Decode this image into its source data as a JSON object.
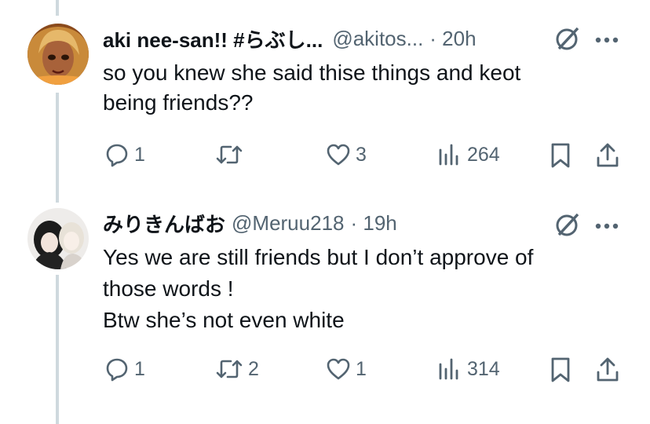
{
  "tweets": [
    {
      "name": "aki nee-san!! #らぶし...",
      "handle": "@akitos...",
      "time": "· 20h",
      "lines": [
        "so you knew she said thise things and keot",
        "being friends??"
      ],
      "replies": "1",
      "retweets": "",
      "likes": "3",
      "views": "264"
    },
    {
      "name": "みりきんばお",
      "handle": "@Meruu218",
      "time": "· 19h",
      "lines": [
        "Yes we are still friends but I don’t approve of",
        "those words !",
        "Btw she’s not even white"
      ],
      "replies": "1",
      "retweets": "2",
      "likes": "1",
      "views": "314"
    }
  ],
  "icons": [
    "grok-icon",
    "more-icon",
    "reply-icon",
    "retweet-icon",
    "like-icon",
    "views-icon",
    "bookmark-icon",
    "share-icon"
  ],
  "colors": {
    "text": "#0f1419",
    "secondary": "#536471",
    "thread_line": "#cfd9de"
  }
}
